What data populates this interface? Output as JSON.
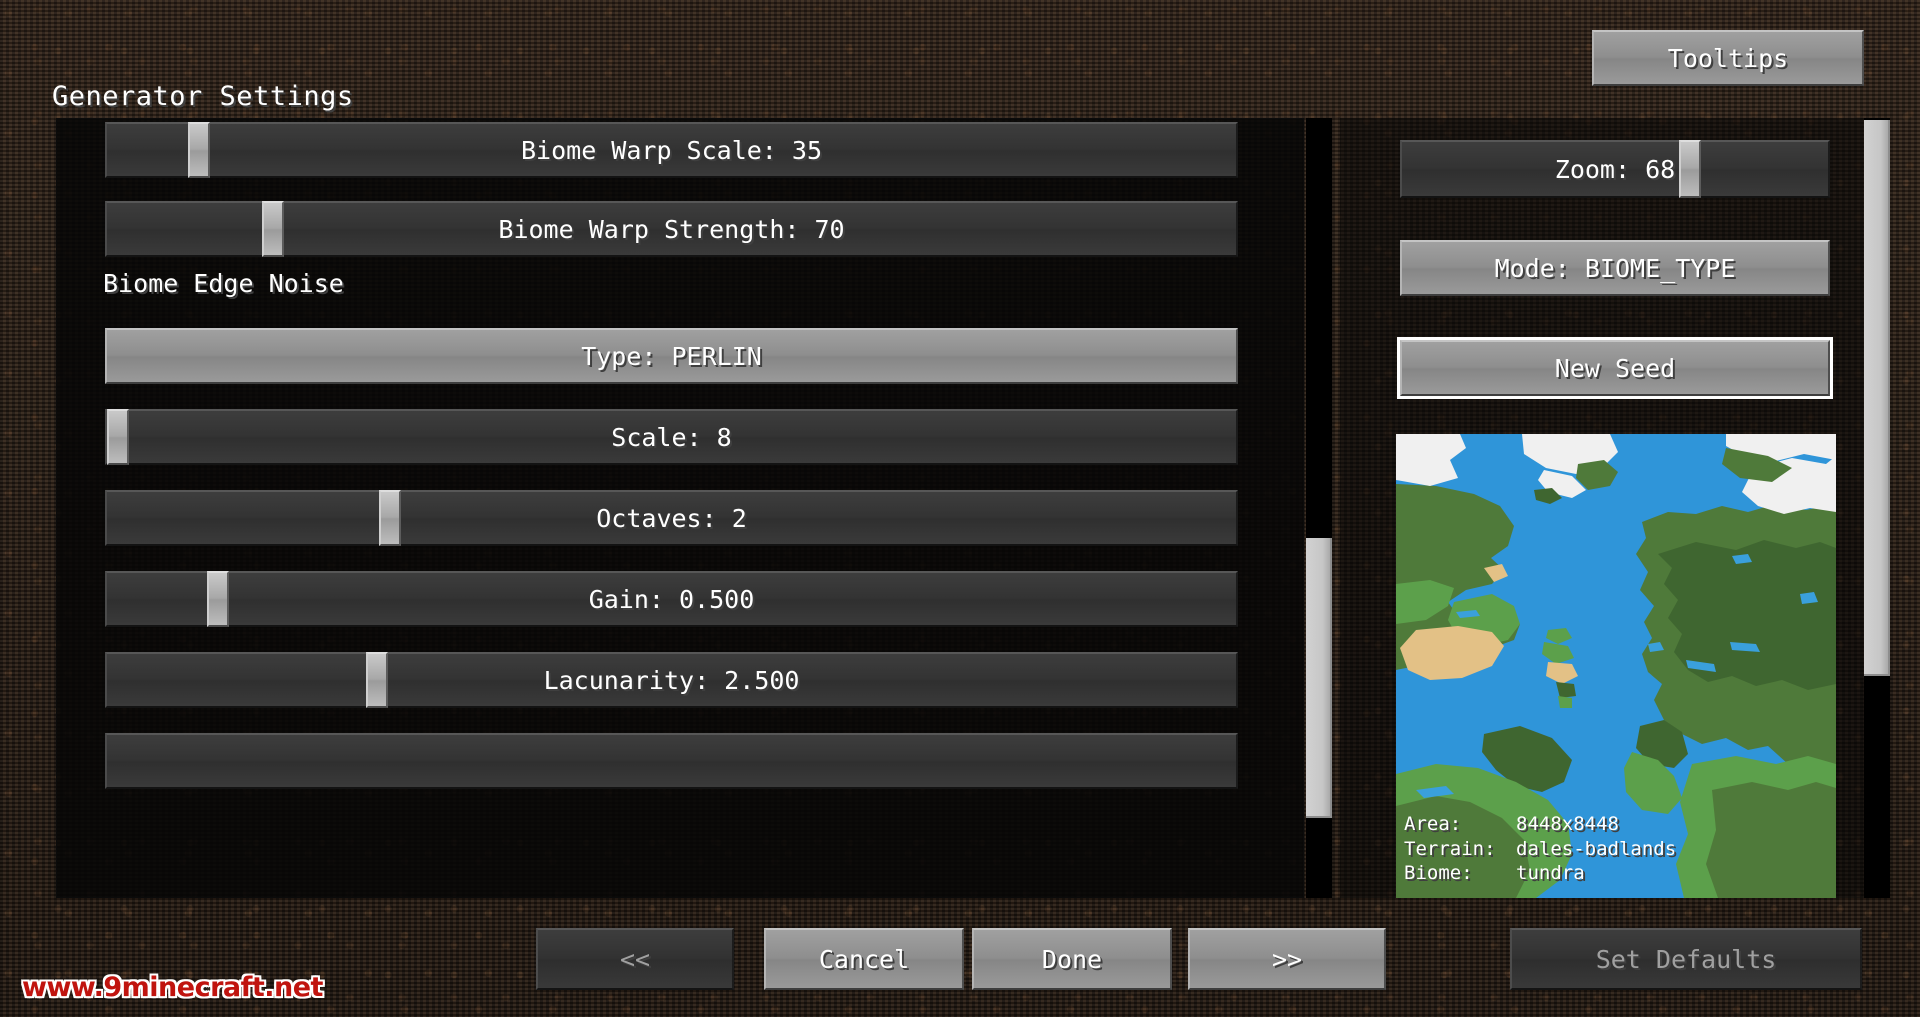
{
  "window": {
    "title": "Generator Settings",
    "background_color": "#2b211a"
  },
  "header": {
    "tooltips_label": "Tooltips"
  },
  "settings_list": {
    "rows": [
      {
        "kind": "slider",
        "label": "Biome Warp Scale: 35",
        "name": "biome-warp-scale",
        "value": 35,
        "fill": 0.075
      },
      {
        "kind": "slider",
        "label": "Biome Warp Strength: 70",
        "name": "biome-warp-strength",
        "value": 70,
        "fill": 0.142
      },
      {
        "kind": "heading",
        "label": "Biome Edge Noise",
        "name": "biome-edge-noise"
      },
      {
        "kind": "button",
        "label": "Type: PERLIN",
        "name": "noise-type",
        "value": "PERLIN",
        "hovered": true
      },
      {
        "kind": "slider",
        "label": "Scale: 8",
        "name": "noise-scale",
        "value": 8,
        "fill": 0.012
      },
      {
        "kind": "slider",
        "label": "Octaves: 2",
        "name": "noise-octaves",
        "value": 2,
        "fill": 0.252
      },
      {
        "kind": "slider",
        "label": "Gain: 0.500",
        "name": "noise-gain",
        "value": 0.5,
        "fill": 0.097
      },
      {
        "kind": "slider",
        "label": "Lacunarity: 2.500",
        "name": "noise-lacunarity",
        "value": 2.5,
        "fill": 0.24
      }
    ]
  },
  "preview_panel": {
    "zoom": {
      "label": "Zoom: 68",
      "value": 68,
      "fill": 0.645
    },
    "mode": {
      "label": "Mode: BIOME_TYPE",
      "value": "BIOME_TYPE",
      "hovered": true
    },
    "new_seed": {
      "label": "New Seed",
      "focused": true
    },
    "map_info": [
      {
        "key": "Area:",
        "value": "8448x8448"
      },
      {
        "key": "Terrain:",
        "value": "dales-badlands"
      },
      {
        "key": "Biome:",
        "value": "tundra"
      }
    ],
    "map_colors": {
      "ocean": "#2f95d9",
      "forest": "#4f7a3a",
      "dark_forest": "#3f6630",
      "plains": "#5ca04b",
      "desert": "#e3c186",
      "snow": "#f0f0f0",
      "lake": "#3aa0dc"
    }
  },
  "footer": {
    "prev_label": "<<",
    "cancel_label": "Cancel",
    "done_label": "Done",
    "next_label": ">>",
    "set_defaults_label": "Set Defaults"
  },
  "watermark": {
    "text": "www.9minecraft.net"
  }
}
